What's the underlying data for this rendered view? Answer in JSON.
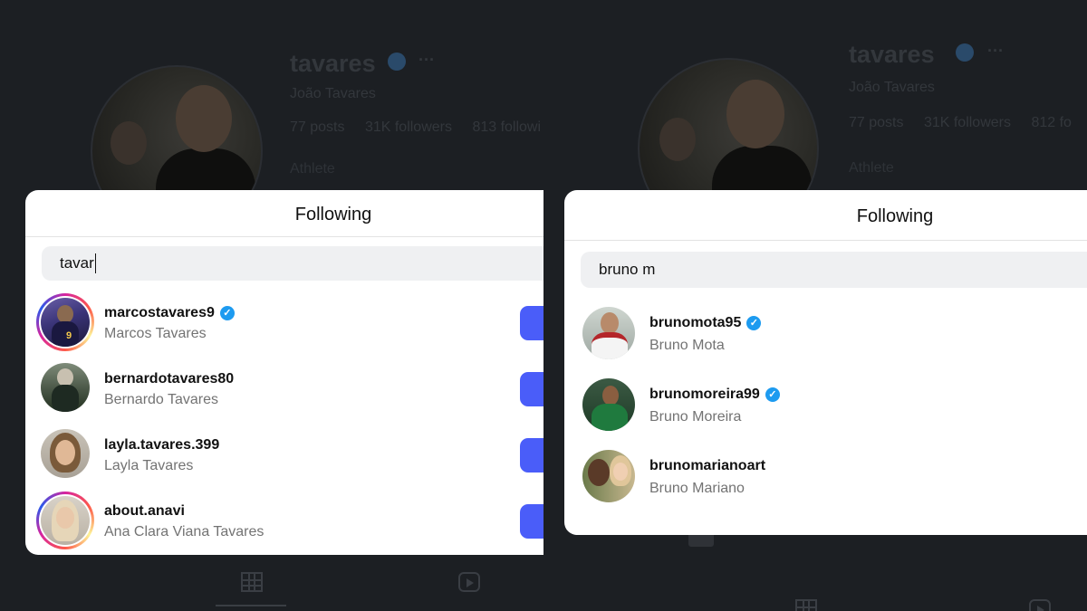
{
  "profile": {
    "username": "tavares",
    "full_name": "João Tavares",
    "more": "···",
    "category": "Athlete",
    "left": {
      "posts": "77 posts",
      "followers": "31K followers",
      "following": "813 followi"
    },
    "right": {
      "posts": "77 posts",
      "followers": "31K followers",
      "following": "812 fo"
    }
  },
  "left_modal": {
    "title": "Following",
    "search_value": "tavar",
    "users": [
      {
        "username": "marcostavares9",
        "full_name": "Marcos Tavares",
        "verified": true,
        "story": true
      },
      {
        "username": "bernardotavares80",
        "full_name": "Bernardo Tavares",
        "verified": false,
        "story": false
      },
      {
        "username": "layla.tavares.399",
        "full_name": "Layla Tavares",
        "verified": false,
        "story": false
      },
      {
        "username": "about.anavi",
        "full_name": "Ana Clara Viana Tavares",
        "verified": false,
        "story": true
      }
    ]
  },
  "right_modal": {
    "title": "Following",
    "search_value": "bruno m",
    "users": [
      {
        "username": "brunomota95",
        "full_name": "Bruno Mota",
        "verified": true
      },
      {
        "username": "brunomoreira99",
        "full_name": "Bruno Moreira",
        "verified": true
      },
      {
        "username": "brunomarianoart",
        "full_name": "Bruno Mariano",
        "verified": false
      }
    ]
  },
  "colors": {
    "verified": "#1d9bf0",
    "follow_button": "#4a5df9",
    "background": "#1c1f23"
  },
  "icons": [
    "verified-badge-icon",
    "grid-tab-icon",
    "reels-tab-icon",
    "more-icon"
  ]
}
